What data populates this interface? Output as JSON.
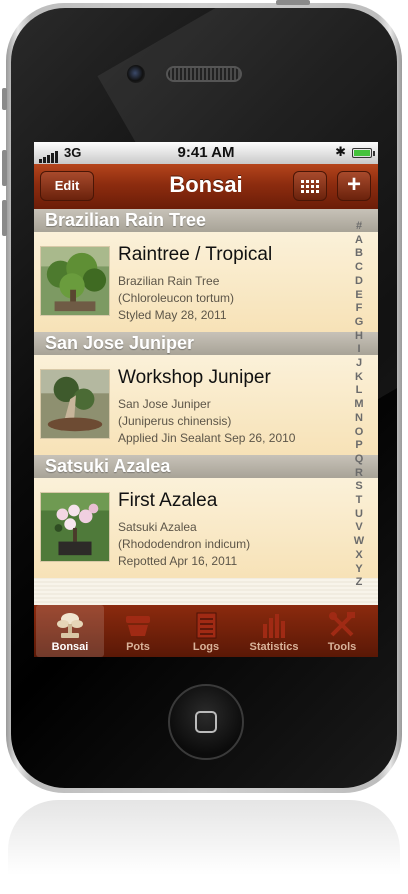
{
  "status_bar": {
    "carrier": "3G",
    "time": "9:41 AM",
    "battery_level": 1.0
  },
  "nav": {
    "title": "Bonsai",
    "edit_label": "Edit",
    "add_label": "+",
    "grid_icon": "grid-view-icon"
  },
  "sections": [
    {
      "header": "Brazilian Rain Tree",
      "item": {
        "title": "Raintree / Tropical",
        "line1": "Brazilian Rain Tree",
        "line2": "(Chloroleucon tortum)",
        "line3": "Styled May 28, 2011"
      }
    },
    {
      "header": "San Jose Juniper",
      "item": {
        "title": "Workshop Juniper",
        "line1": "San Jose Juniper",
        "line2": "(Juniperus chinensis)",
        "line3": "Applied Jin Sealant Sep 26, 2010"
      }
    },
    {
      "header": "Satsuki Azalea",
      "item": {
        "title": "First Azalea",
        "line1": "Satsuki Azalea",
        "line2": "(Rhododendron indicum)",
        "line3": "Repotted Apr 16, 2011"
      }
    }
  ],
  "index_letters": [
    "#",
    "A",
    "B",
    "C",
    "D",
    "E",
    "F",
    "G",
    "H",
    "I",
    "J",
    "K",
    "L",
    "M",
    "N",
    "O",
    "P",
    "Q",
    "R",
    "S",
    "T",
    "U",
    "V",
    "W",
    "X",
    "Y",
    "Z"
  ],
  "tabs": [
    {
      "label": "Bonsai",
      "icon": "bonsai-tree-icon",
      "active": true
    },
    {
      "label": "Pots",
      "icon": "pot-icon",
      "active": false
    },
    {
      "label": "Logs",
      "icon": "log-book-icon",
      "active": false
    },
    {
      "label": "Statistics",
      "icon": "bar-chart-icon",
      "active": false
    },
    {
      "label": "Tools",
      "icon": "tools-icon",
      "active": false
    }
  ],
  "colors": {
    "nav_brown": "#8d2c0f",
    "row_cream": "#f7e2b7",
    "section_gray": "#b3aea3",
    "tab_active_text": "#ffffff"
  }
}
